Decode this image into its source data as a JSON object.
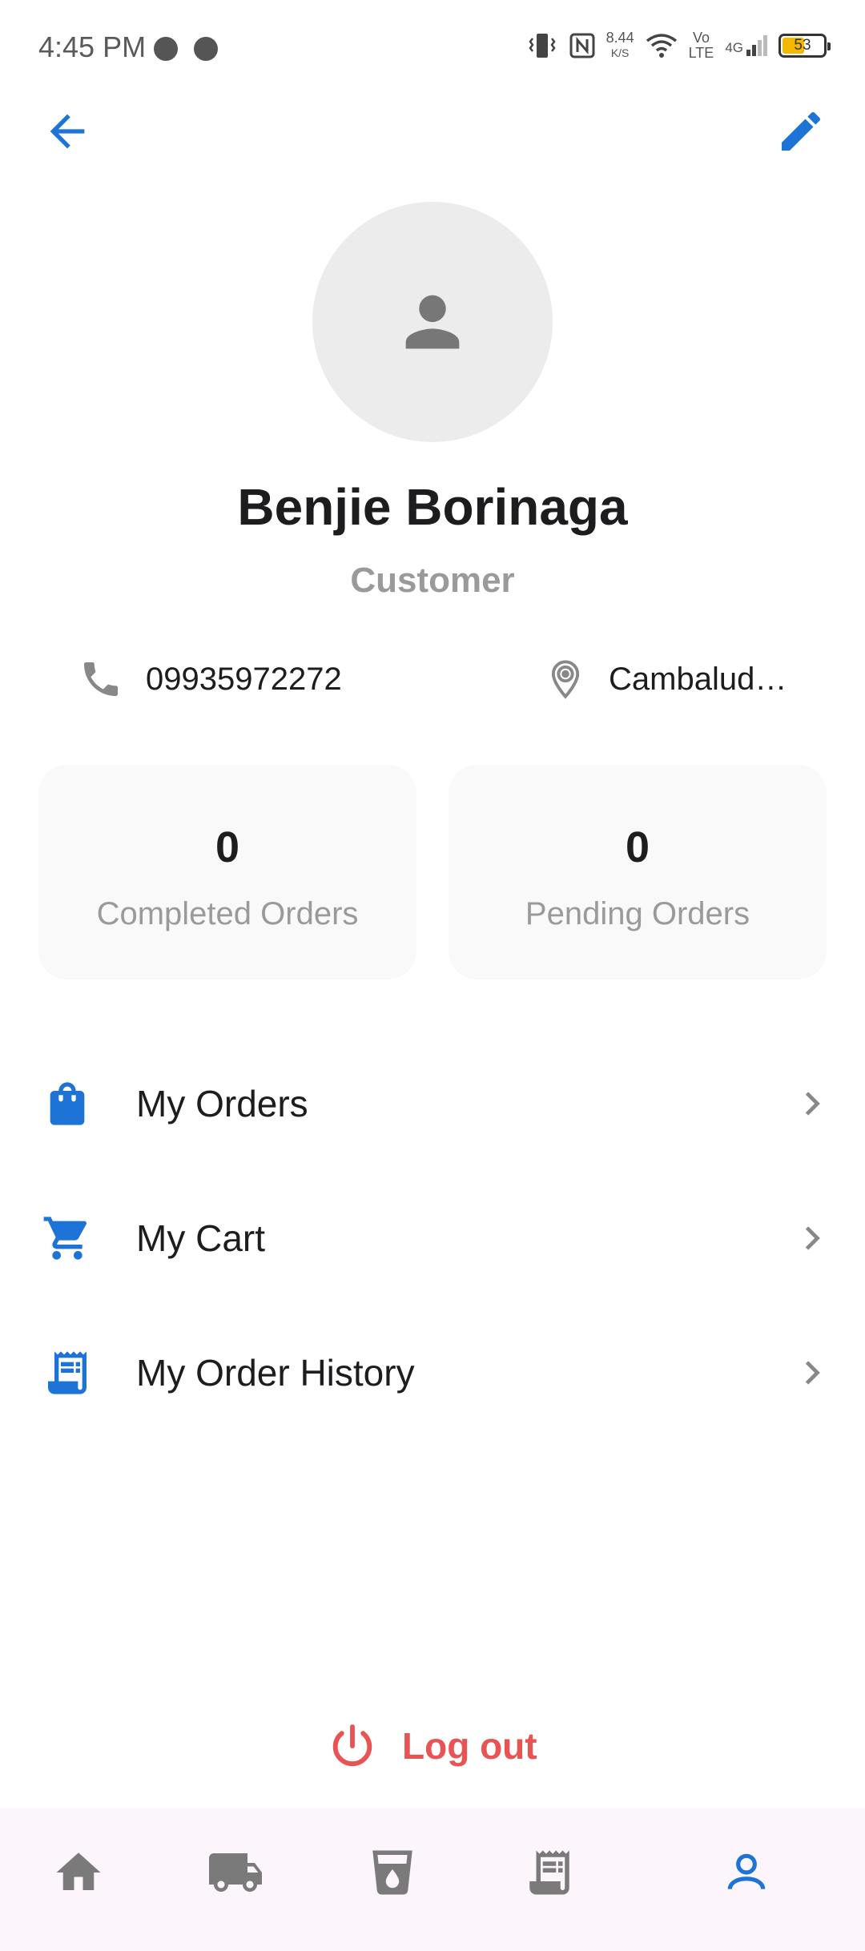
{
  "status_bar": {
    "time": "4:45 PM",
    "speed_value": "8.44",
    "speed_unit": "K/S",
    "volte_top": "Vo",
    "volte_bottom": "LTE",
    "network": "4G",
    "battery": "53"
  },
  "profile": {
    "name": "Benjie Borinaga",
    "role": "Customer",
    "phone": "09935972272",
    "location": "Cambalud…"
  },
  "stats": [
    {
      "count": "0",
      "label": "Completed Orders"
    },
    {
      "count": "0",
      "label": "Pending Orders"
    }
  ],
  "menu": [
    {
      "label": "My Orders",
      "icon": "shopping-bag-icon"
    },
    {
      "label": "My Cart",
      "icon": "cart-icon"
    },
    {
      "label": "My Order History",
      "icon": "receipt-icon"
    }
  ],
  "logout_label": "Log out",
  "bottom_nav": [
    {
      "icon": "home-icon",
      "active": false
    },
    {
      "icon": "truck-icon",
      "active": false
    },
    {
      "icon": "water-glass-icon",
      "active": false
    },
    {
      "icon": "receipt-icon",
      "active": false
    },
    {
      "icon": "person-icon",
      "active": true
    }
  ],
  "colors": {
    "accent": "#1e74d6",
    "danger": "#e85454",
    "muted": "#9a9a9a",
    "nav_inactive": "#7a7a7a",
    "nav_bg": "#fcf5fb"
  }
}
